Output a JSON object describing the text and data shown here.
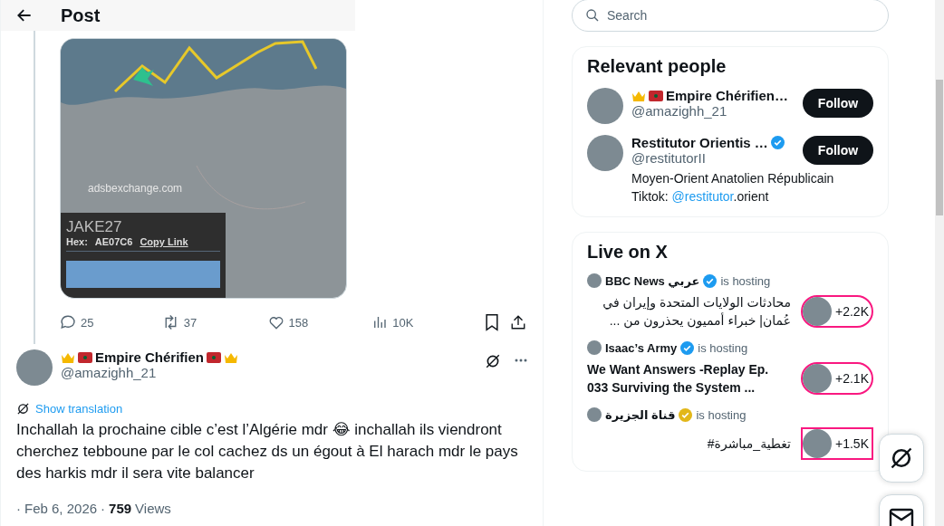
{
  "header": {
    "title": "Post"
  },
  "media": {
    "site": "adsbexchange.com",
    "callsign": "JAKE27",
    "hex_label": "Hex:",
    "hex": "AE07C6",
    "link": "Copy Link"
  },
  "actions": [
    {
      "kind": "reply",
      "count": "25"
    },
    {
      "kind": "repost",
      "count": "37"
    },
    {
      "kind": "like",
      "count": "158"
    },
    {
      "kind": "views",
      "count": "10K"
    },
    {
      "kind": "bookmark"
    },
    {
      "kind": "share"
    }
  ],
  "reply": {
    "name": "Empire Chérifien",
    "badges_before": [
      {
        "kind": "crown"
      },
      {
        "kind": "flag"
      }
    ],
    "badges_after": [
      {
        "kind": "flag"
      },
      {
        "kind": "crown"
      }
    ],
    "separator": "·",
    "handle": "@amazighh_21",
    "translate": "Show translation",
    "text": "Inchallah la prochaine cible c’est l’Algérie mdr 😂 inchallah ils viendront cherchez tebboune par le col cachez ds un égout à El harach mdr le pays des harkis mdr il sera vite balancer",
    "date": "Feb 6, 2026",
    "views_count": "759",
    "views_label": "Views"
  },
  "search": {
    "placeholder": "Search"
  },
  "relevant": {
    "title": "Relevant people",
    "people": [
      {
        "name": "Empire Chérifien…",
        "badges_before": [
          {
            "kind": "crown"
          },
          {
            "kind": "flag"
          }
        ],
        "verified": false,
        "handle": "@amazighh_21",
        "button": "Follow"
      },
      {
        "name": "Restitutor Orientis …",
        "verified": true,
        "handle": "@restitutorII",
        "button": "Follow",
        "bio": {
          "line": "Moyen-Orient Anatolien Républicain",
          "prefix": "Tiktok: ",
          "link": "@restitutor",
          "suffix": ".orient"
        }
      }
    ]
  },
  "live": {
    "title": "Live on X",
    "items": [
      {
        "host": "BBC News عربي",
        "verified": true,
        "color": "#1d9bf0",
        "status": "is hosting",
        "title": "محادثات الولايات المتحدة وإيران في عُمان| خبراء أمميون يحذرون من ...",
        "bold": false,
        "count": "+2.2K",
        "kind": "pill"
      },
      {
        "host": "Isaac’s Army",
        "verified": true,
        "color": "#1d9bf0",
        "status": "is hosting",
        "title": "We Want Answers -Replay Ep. 033 Surviving the System ...",
        "bold": true,
        "count": "+2.1K",
        "kind": "pill"
      },
      {
        "host": "قناة الجزيرة",
        "verified": true,
        "color": "#e2b719",
        "status": "is hosting",
        "title": "تغطية_مباشرة#",
        "bold": false,
        "count": "+1.5K",
        "kind": "square"
      }
    ]
  }
}
